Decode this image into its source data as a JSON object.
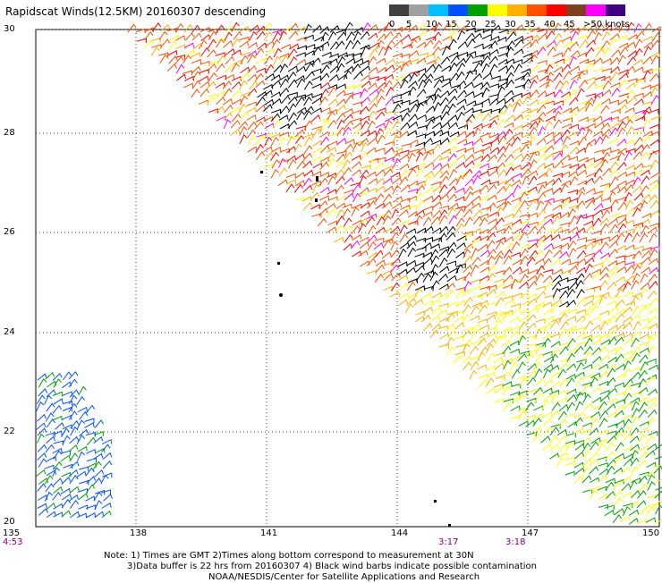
{
  "title": "Rapidscat Winds(12.5KM) 20160307 descending",
  "legend": {
    "labels": [
      "0",
      "5",
      "10",
      "15",
      "20",
      "25",
      "30",
      "35",
      "40",
      "45",
      ">50 knots"
    ],
    "colors": [
      "#404040",
      "#a0a0a0",
      "#00c0ff",
      "#0050ff",
      "#00a000",
      "#ffff00",
      "#ffb000",
      "#ff5000",
      "#ff0000",
      "#804020",
      "#ff00ff",
      "#400080"
    ]
  },
  "lat_labels": [
    "30",
    "28",
    "26",
    "24",
    "22",
    "20"
  ],
  "lon_labels": [
    "135",
    "138",
    "141",
    "144",
    "147",
    "150"
  ],
  "times": [
    "4:53",
    "3:17",
    "3:18"
  ],
  "notes": [
    "Note: 1) Times are GMT 2)Times along bottom correspond to measurement at 30N",
    "3)Data buffer is 22 hrs from 20160307 4) Black wind barbs indicate possible contamination",
    "NOAA/NESDIS/Center for Satellite Applications and Research"
  ]
}
